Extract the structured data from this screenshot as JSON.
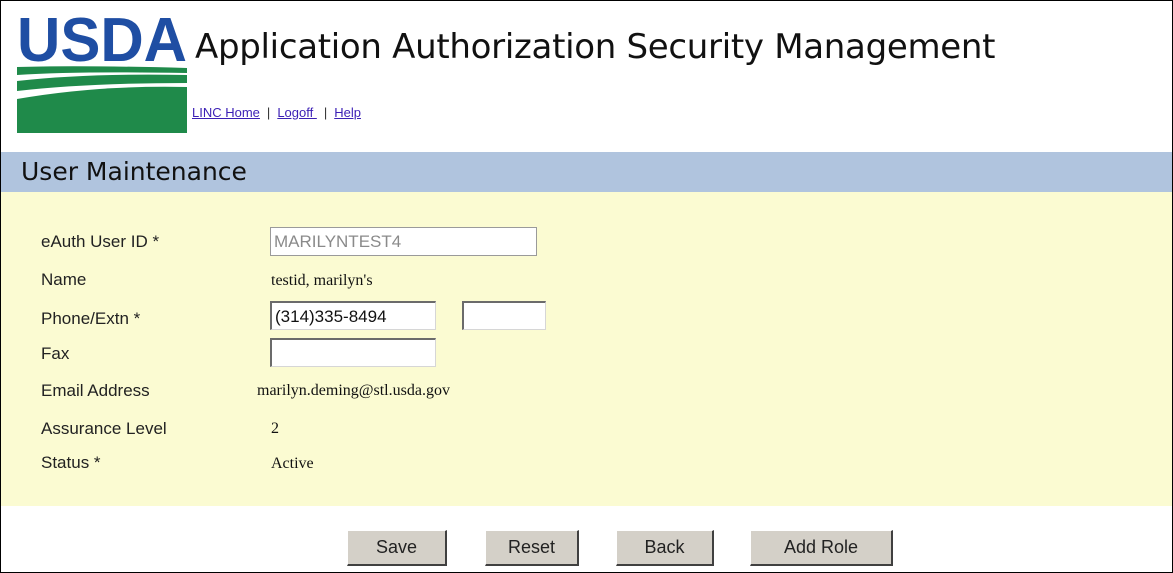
{
  "header": {
    "logo_text": "USDA",
    "title": "Application Authorization Security Management",
    "links": [
      {
        "label": "LINC Home"
      },
      {
        "label": "Logoff "
      },
      {
        "label": "Help"
      }
    ],
    "separator": "|"
  },
  "section": {
    "title": "User Maintenance"
  },
  "form": {
    "eauth_user_id": {
      "label": "eAuth User ID *",
      "value": "MARILYNTEST4"
    },
    "name": {
      "label": "Name",
      "value": "testid, marilyn's"
    },
    "phone": {
      "label": "Phone/Extn *",
      "value": "(314)335-8494",
      "extension": ""
    },
    "fax": {
      "label": "Fax",
      "value": ""
    },
    "email": {
      "label": "Email Address",
      "value": "marilyn.deming@stl.usda.gov"
    },
    "assurance_level": {
      "label": "Assurance Level",
      "value": "2"
    },
    "status": {
      "label": "Status *",
      "value": "Active"
    }
  },
  "buttons": {
    "save": "Save",
    "reset": "Reset",
    "back": "Back",
    "add_role": "Add Role"
  },
  "colors": {
    "section_bar": "#b0c4de",
    "form_panel": "#fbfbd2",
    "logo_blue": "#1f4ea3",
    "logo_green": "#1f8a4a",
    "link": "#3b1fb5",
    "button_face": "#d4d0c8"
  }
}
